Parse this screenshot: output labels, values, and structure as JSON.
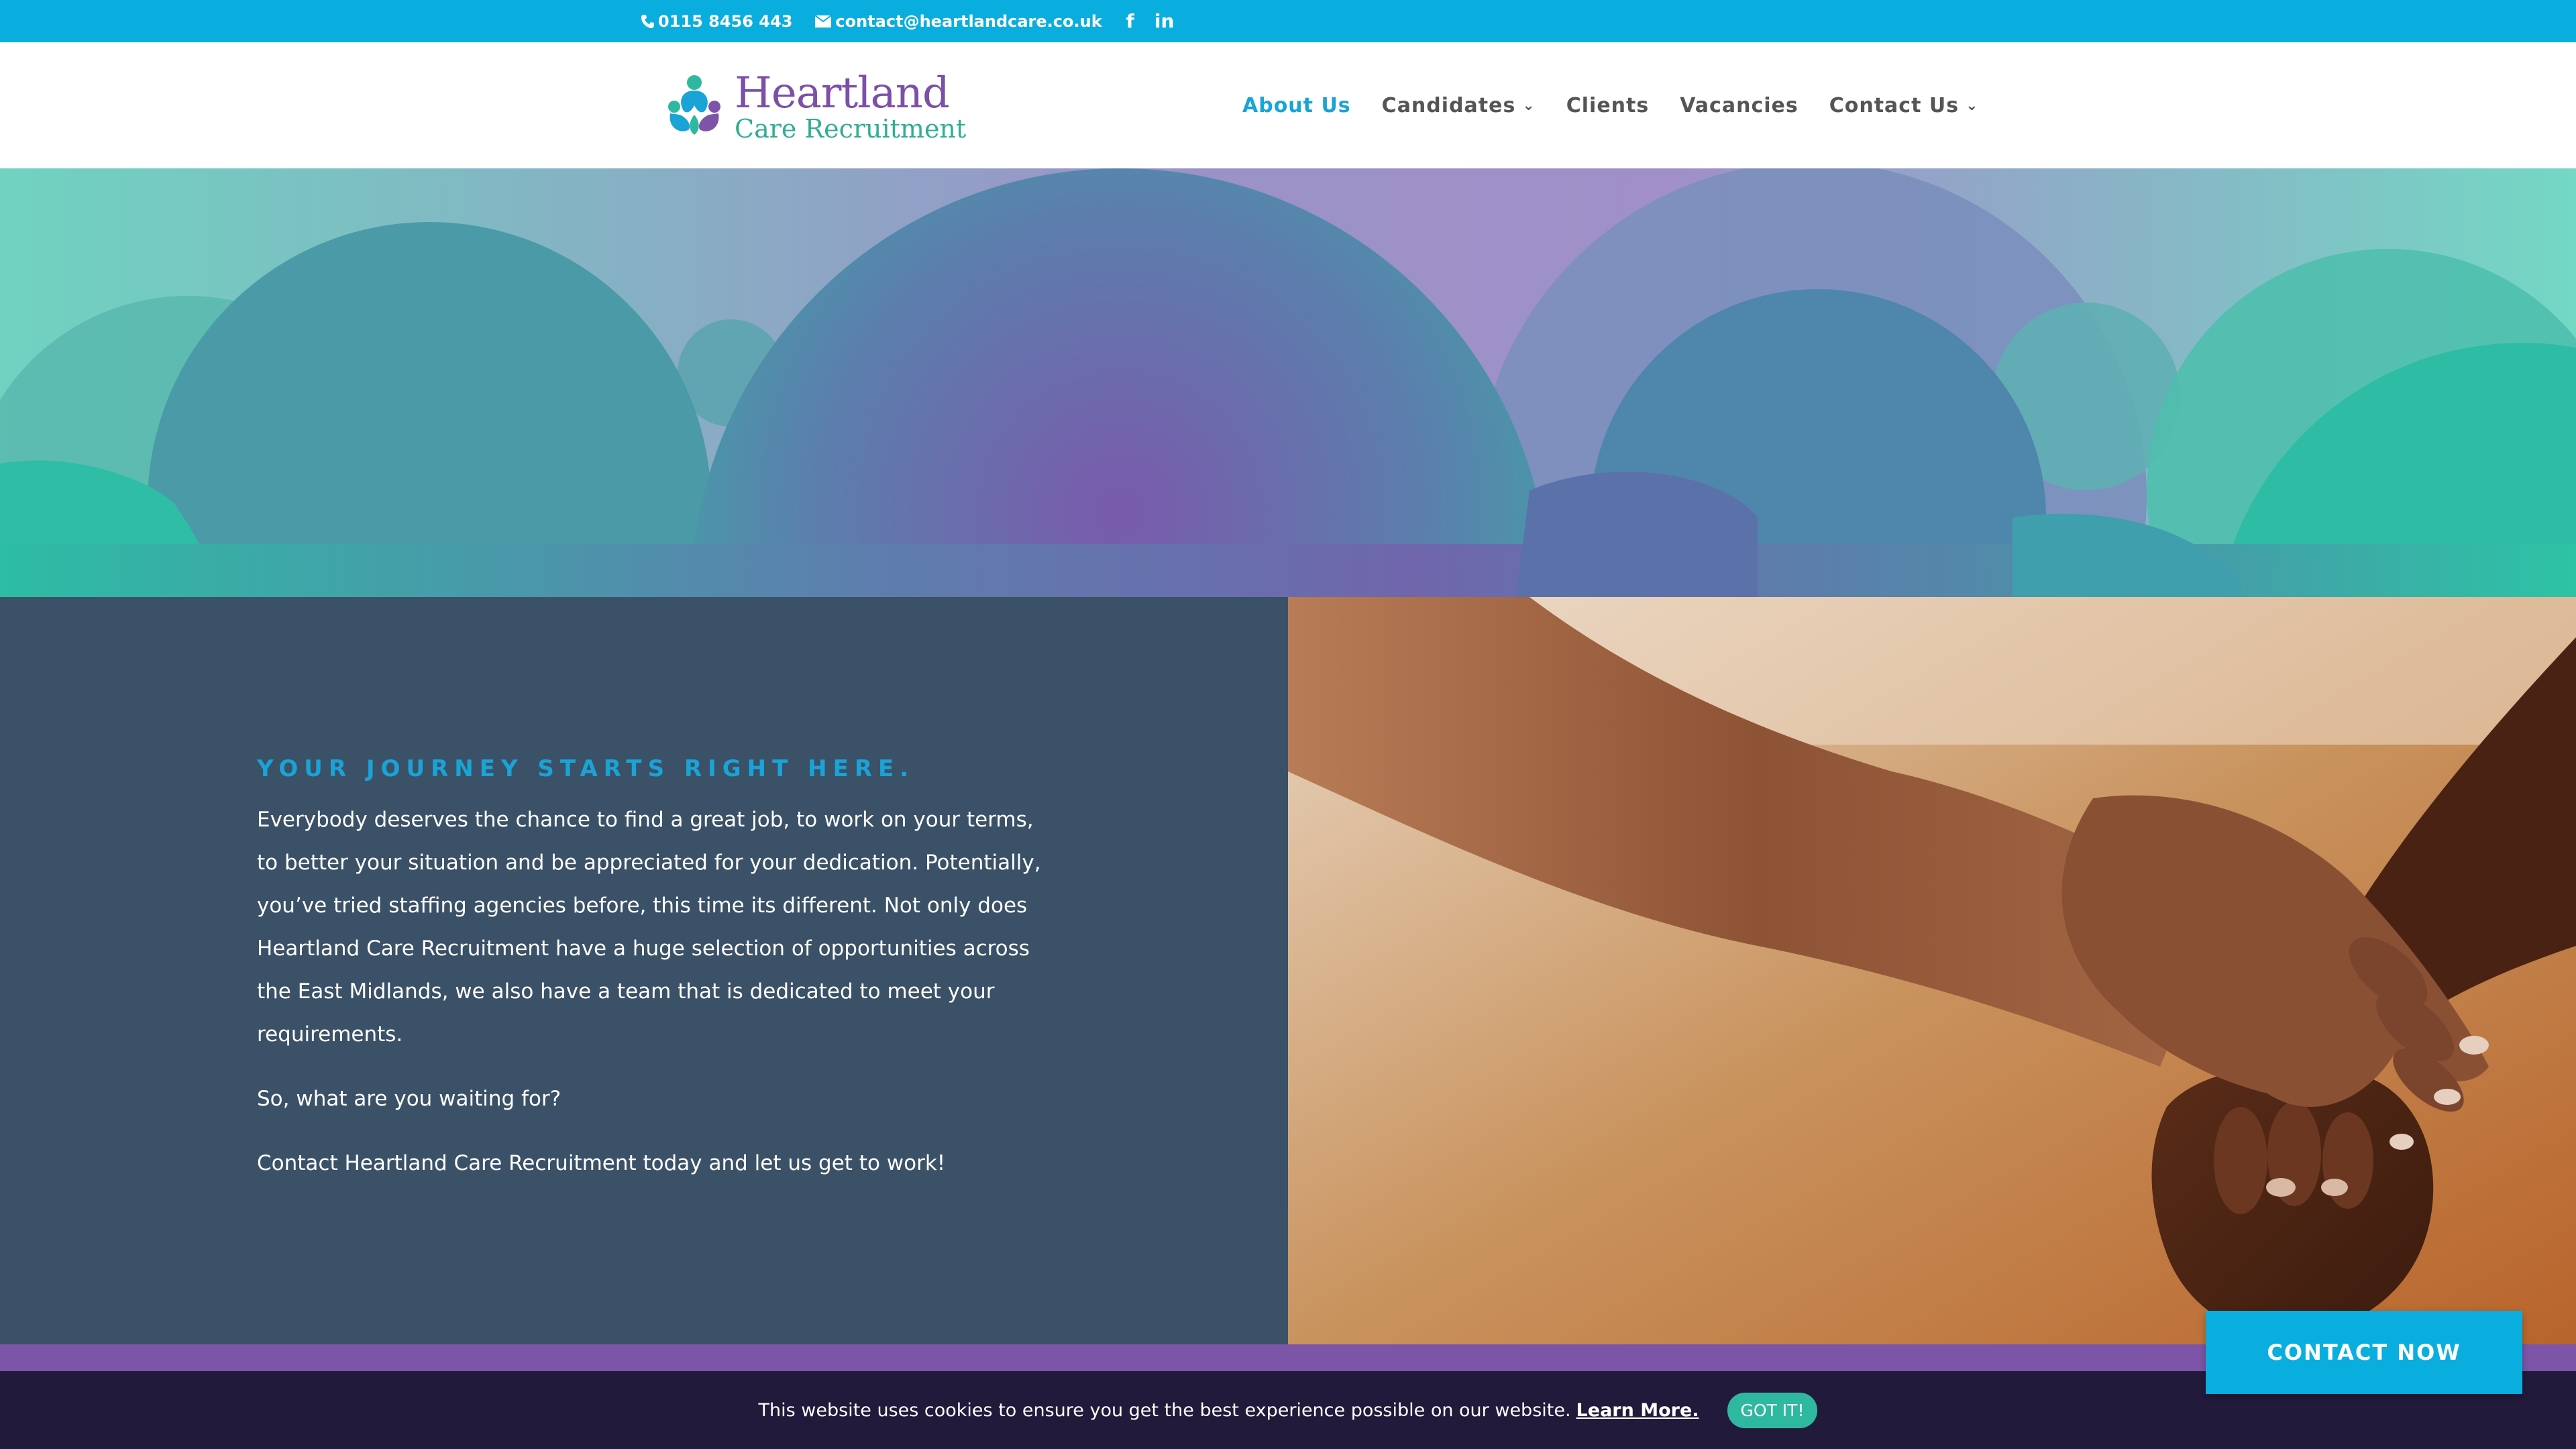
{
  "topbar": {
    "phone": "0115 8456 443",
    "email": "contact@heartlandcare.co.uk",
    "social": [
      "f",
      "in"
    ],
    "icons": [
      "phone-icon",
      "mail-icon",
      "facebook-icon",
      "linkedin-icon"
    ],
    "bg_color": "#0aaede"
  },
  "header": {
    "logo_name": "Heartland",
    "logo_sub": "Care Recruitment",
    "nav": [
      {
        "label": "About Us",
        "active": true,
        "dropdown": false
      },
      {
        "label": "Candidates",
        "active": false,
        "dropdown": true
      },
      {
        "label": "Clients",
        "active": false,
        "dropdown": false
      },
      {
        "label": "Vacancies",
        "active": false,
        "dropdown": false
      },
      {
        "label": "Contact Us",
        "active": false,
        "dropdown": true
      }
    ],
    "dropdown_glyph": "⌄",
    "accent_color": "#1aa3d6"
  },
  "content": {
    "eyebrow": "YOUR JOURNEY STARTS RIGHT HERE.",
    "paragraphs": [
      "Everybody deserves the chance to find a great job, to work on your terms, to better your situation and be appreciated for your dedication. Potentially, you’ve tried staffing agencies before, this time its different. Not only does Heartland Care Recruitment have a huge selection of opportunities across the East Midlands, we also have a team that is dedicated to meet your requirements.",
      "So, what are you waiting for?",
      "Contact Heartland Care Recruitment today and let us get to work!"
    ],
    "bg_color": "#3b5167"
  },
  "cookie": {
    "text": "This website uses cookies to ensure you get the best experience possible on our website.",
    "learn_more": "Learn More.",
    "button": "GOT IT!"
  },
  "contact_now": "CONTACT NOW",
  "colors": {
    "purple": "#7d55a8",
    "teal": "#2fb8a0",
    "dark": "#211a3b"
  }
}
